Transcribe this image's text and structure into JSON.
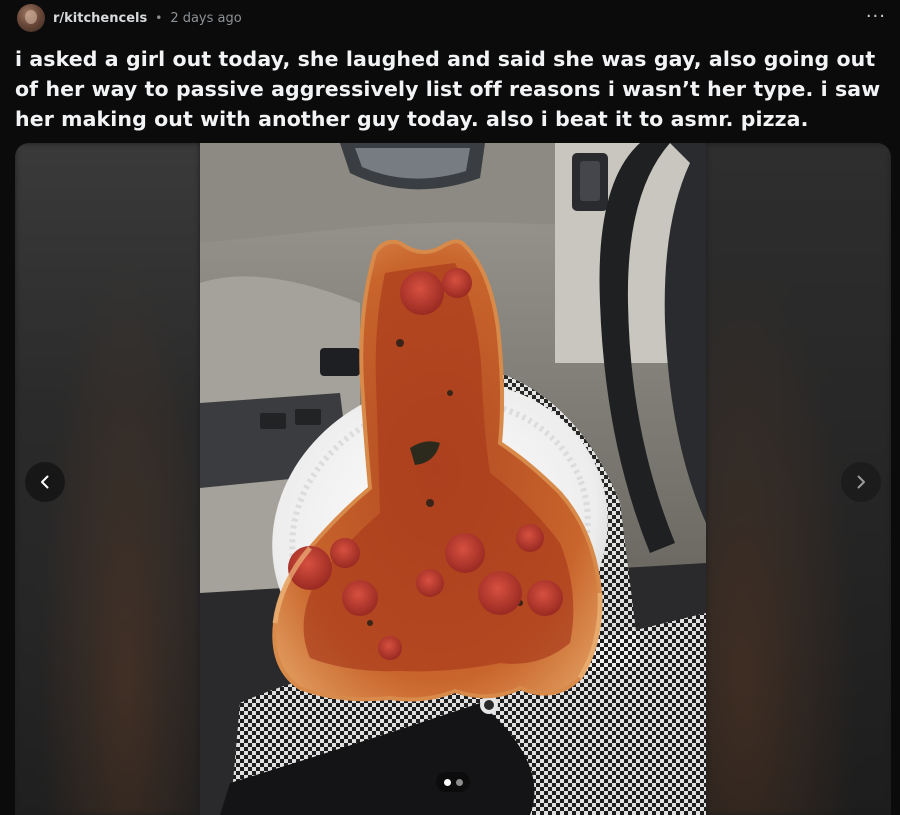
{
  "post": {
    "subreddit": "r/kitchencels",
    "separator": "•",
    "time_ago": "2 days ago",
    "more_label": "···",
    "title": "i asked a girl out today, she laughed and said she was gay, also going out of her way to passive aggressively list off reasons i wasn’t her type. i saw her making out with another guy today. also i beat it to asmr. pizza."
  },
  "media": {
    "image_subject": "pizza on a white paper plate on a lap in a car",
    "gallery": {
      "current_index": 1,
      "total": 2
    },
    "icons": {
      "prev": "chevron-left-icon",
      "next": "chevron-right-icon"
    }
  },
  "colors": {
    "background": "#0b0b0c",
    "title_text": "#f2f3f4",
    "meta_text": "#8b9195",
    "pizza_crust": "#c8642c",
    "pepperoni": "#b2342a"
  }
}
